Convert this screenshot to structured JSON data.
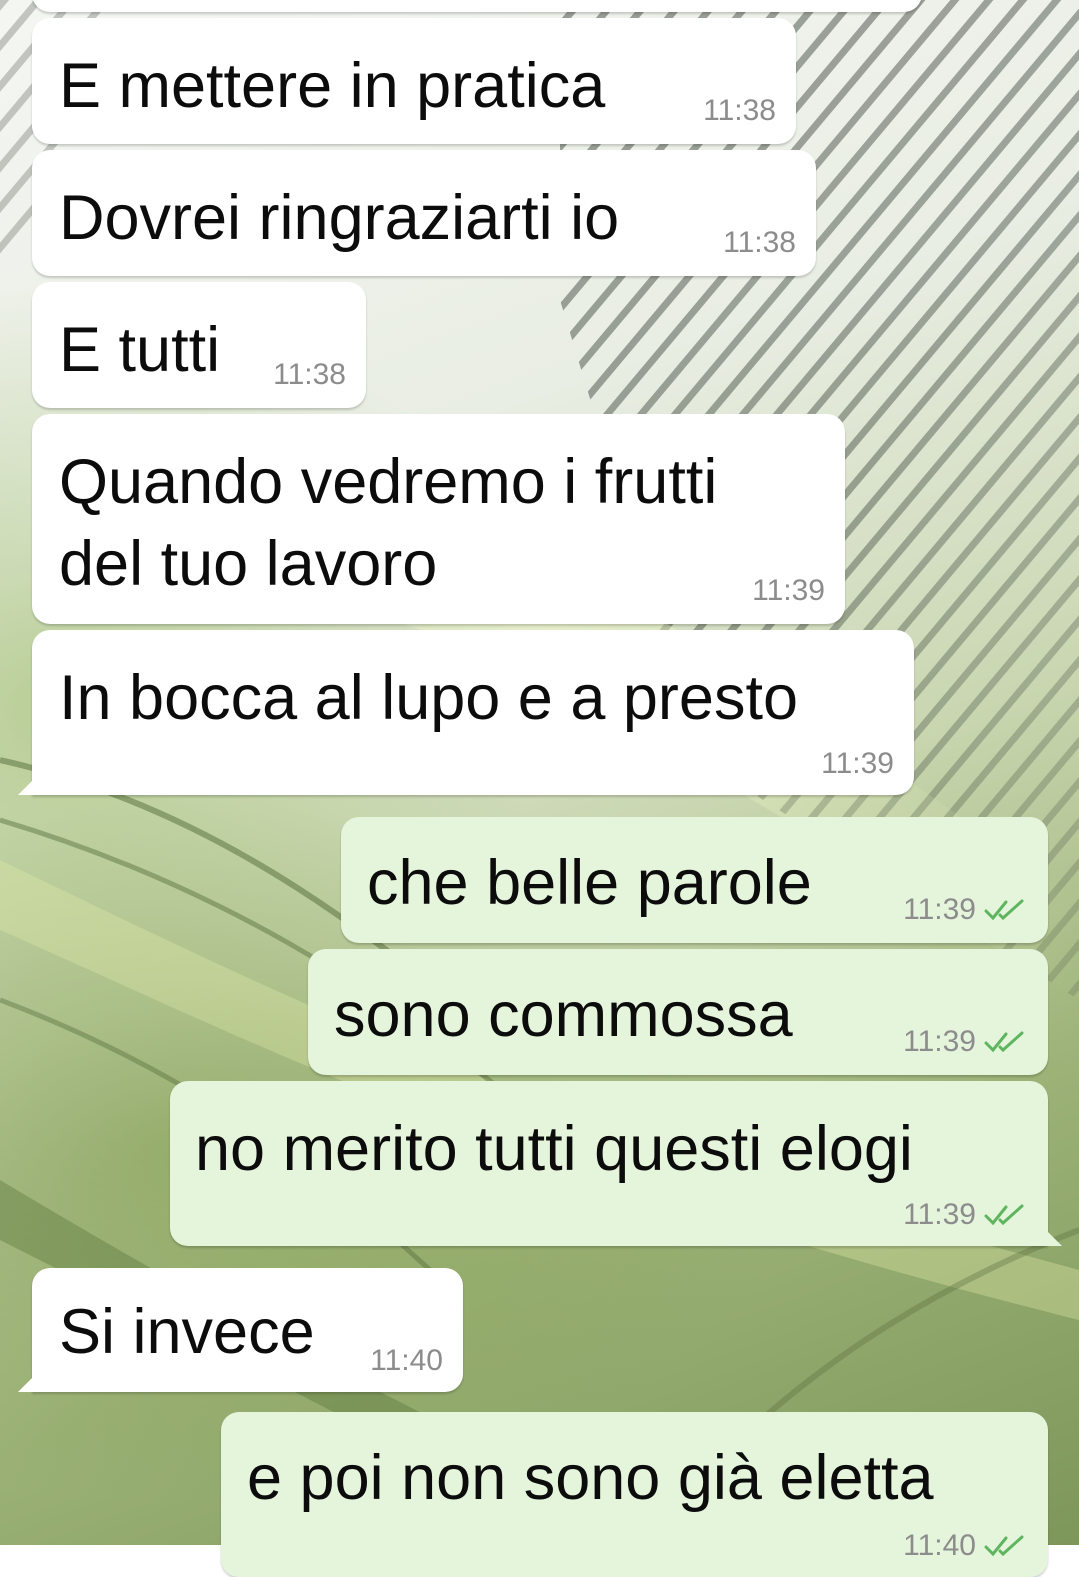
{
  "conversation": {
    "messages": [
      {
        "direction": "incoming",
        "text": "E mettere in pratica",
        "time": "11:38"
      },
      {
        "direction": "incoming",
        "text": "Dovrei ringraziarti io",
        "time": "11:38"
      },
      {
        "direction": "incoming",
        "text": "E tutti",
        "time": "11:38"
      },
      {
        "direction": "incoming",
        "text_line1": "Quando vedremo i frutti",
        "text_line2": "del tuo lavoro",
        "time": "11:39"
      },
      {
        "direction": "incoming",
        "text": "In bocca al lupo e a presto",
        "time": "11:39"
      },
      {
        "direction": "outgoing",
        "text": "che belle parole",
        "time": "11:39",
        "status": "read"
      },
      {
        "direction": "outgoing",
        "text": "sono commossa",
        "time": "11:39",
        "status": "read"
      },
      {
        "direction": "outgoing",
        "text": "no merito tutti questi elogi",
        "time": "11:39",
        "status": "read"
      },
      {
        "direction": "incoming",
        "text": "Si invece",
        "time": "11:40"
      },
      {
        "direction": "outgoing",
        "text": "e poi non sono già eletta",
        "time": "11:40",
        "status": "read"
      }
    ]
  },
  "colors": {
    "incoming_bubble": "#ffffff",
    "outgoing_bubble": "#e5f5dc",
    "read_ticks": "#5fb55f",
    "timestamp": "#8c8c8c"
  },
  "icons": {
    "read_status": "double-check-icon"
  }
}
